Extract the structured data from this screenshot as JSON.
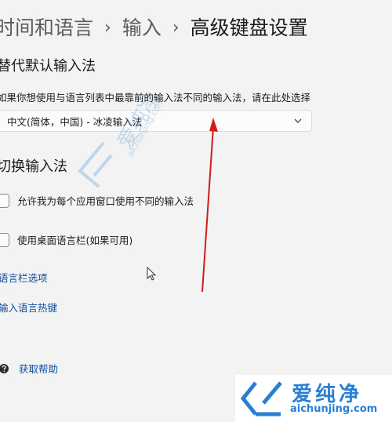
{
  "breadcrumb": {
    "parent": "时间和语言",
    "middle": "输入",
    "current": "高级键盘设置",
    "separator": "›"
  },
  "override_input": {
    "title": "替代默认输入法",
    "description": "如果你想使用与语言列表中最靠前的输入法不同的输入法，请在此处选择",
    "dropdown_value": "中文(简体，中国) - 冰凌输入法"
  },
  "switch_input": {
    "title": "切换输入法",
    "options": [
      {
        "label": "允许我为每个应用窗口使用不同的输入法",
        "checked": false
      },
      {
        "label": "使用桌面语言栏(如果可用)",
        "checked": false
      }
    ]
  },
  "links": {
    "language_bar_options": "语言栏选项",
    "input_hotkeys": "输入语言热键"
  },
  "help": {
    "label": "获取帮助"
  },
  "watermark": {
    "title": "爱纯净",
    "url": "aichunjing.com"
  },
  "colors": {
    "link": "#0d4d9c",
    "arrow": "#d11a1a",
    "watermark": "#2a7fd4",
    "background": "#f3f3f3"
  }
}
